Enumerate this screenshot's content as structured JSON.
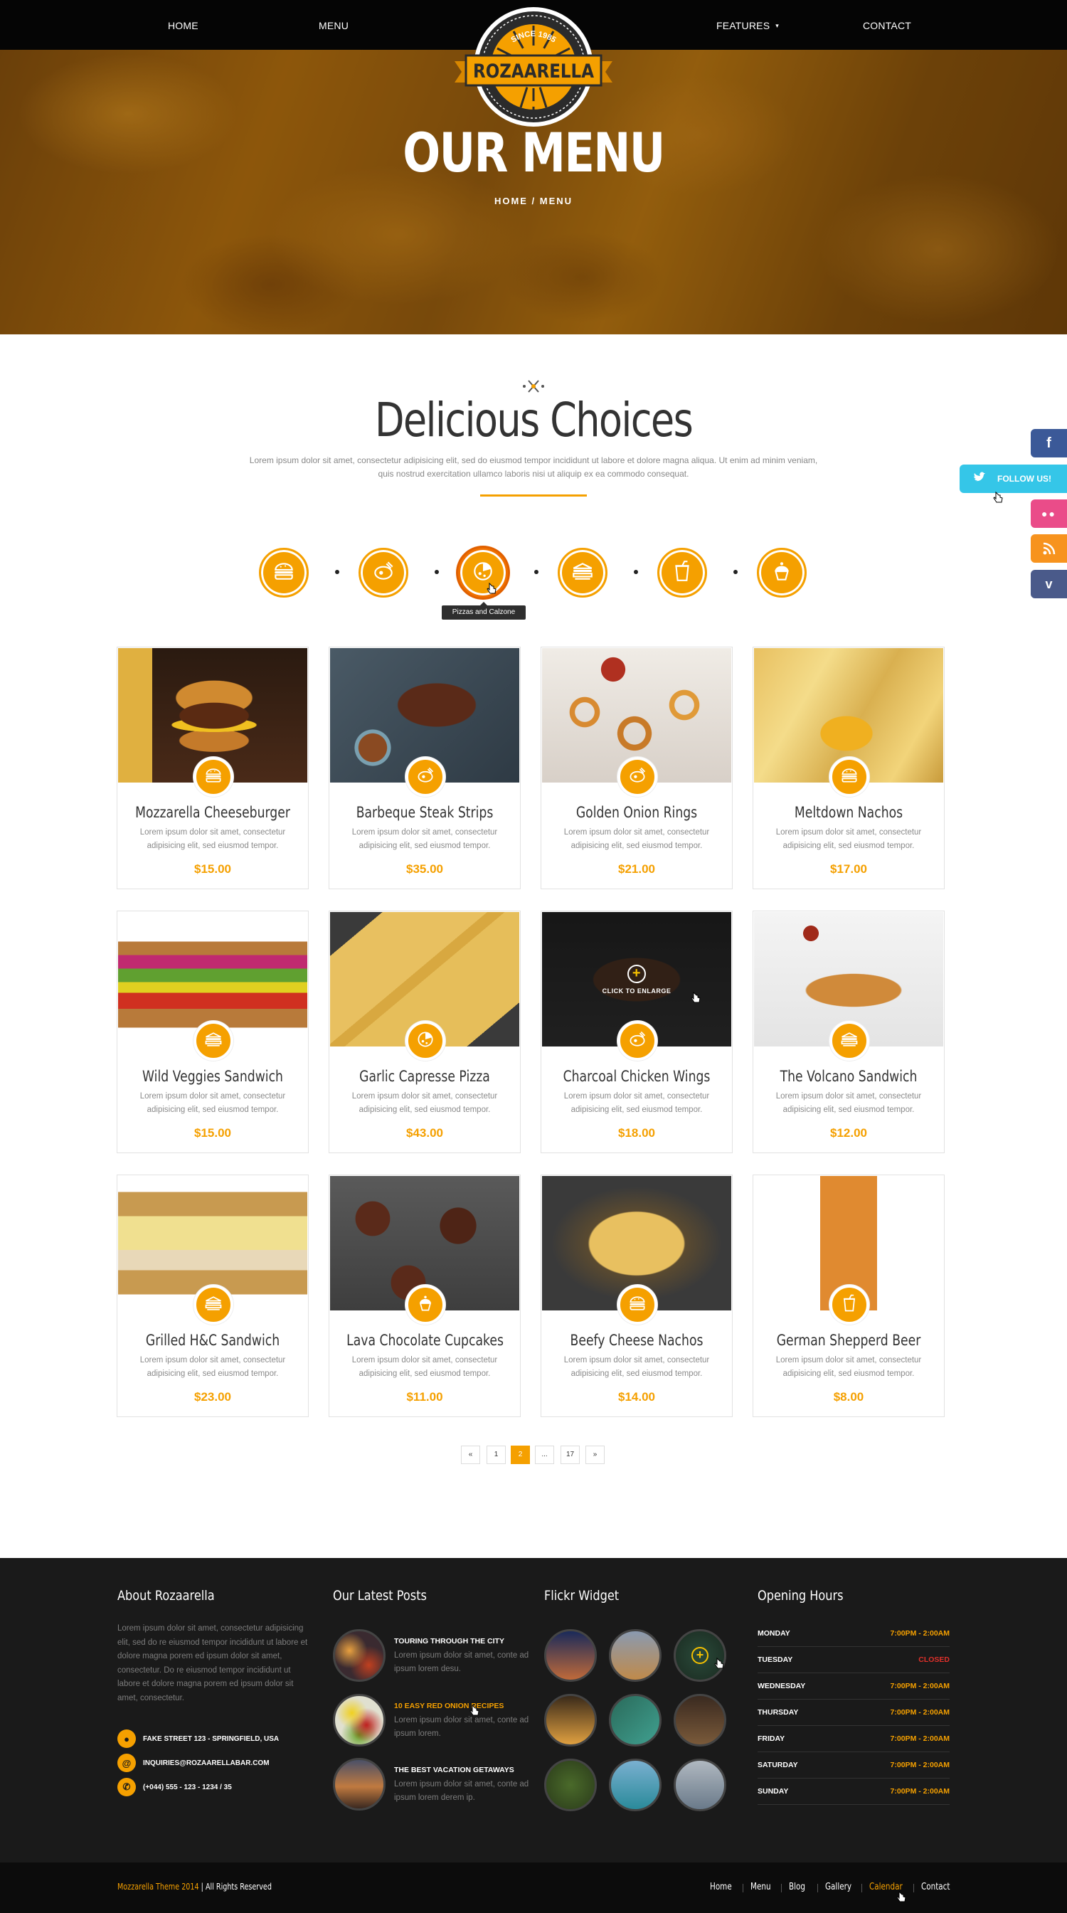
{
  "nav": {
    "home": "HOME",
    "menu": "MENU",
    "features": "FEATURES",
    "contact": "CONTACT"
  },
  "logo": {
    "since": "SINCE 1985",
    "name": "ROZAARELLA"
  },
  "hero": {
    "title": "OUR MENU",
    "breadcrumb": "HOME / MENU"
  },
  "intro": {
    "title": "Delicious Choices",
    "text": "Lorem ipsum dolor sit amet, consectetur adipisicing elit, sed do eiusmod tempor incididunt ut labore et dolore magna aliqua. Ut enim ad minim veniam, quis nostrud exercitation ullamco laboris nisi ut aliquip ex ea commodo consequat."
  },
  "categories": {
    "icons": [
      "burger-icon",
      "steak-icon",
      "pizza-icon",
      "sandwich-icon",
      "drink-icon",
      "cupcake-icon"
    ],
    "active_index": 2,
    "tooltip": "Pizzas and Calzone"
  },
  "colors": {
    "accent": "#f5a000",
    "dark": "#1a1a1a",
    "facebook": "#3b5998",
    "twitter": "#35c6e8",
    "flickr": "#ea4c89",
    "rss": "#f7931e",
    "vimeo": "#4a5a8a"
  },
  "menu_items": [
    {
      "name": "Mozzarella Cheeseburger",
      "desc": "Lorem ipsum dolor sit amet, consectetur adipisicing elit, sed eiusmod tempor.",
      "price": "$15.00",
      "icon": "burger-icon"
    },
    {
      "name": "Barbeque Steak Strips",
      "desc": "Lorem ipsum dolor sit amet, consectetur adipisicing elit, sed eiusmod tempor.",
      "price": "$35.00",
      "icon": "steak-icon"
    },
    {
      "name": "Golden Onion Rings",
      "desc": "Lorem ipsum dolor sit amet, consectetur adipisicing elit, sed eiusmod tempor.",
      "price": "$21.00",
      "icon": "steak-icon"
    },
    {
      "name": "Meltdown Nachos",
      "desc": "Lorem ipsum dolor sit amet, consectetur adipisicing elit, sed eiusmod tempor.",
      "price": "$17.00",
      "icon": "burger-icon"
    },
    {
      "name": "Wild Veggies Sandwich",
      "desc": "Lorem ipsum dolor sit amet, consectetur adipisicing elit, sed eiusmod tempor.",
      "price": "$15.00",
      "icon": "sandwich-icon"
    },
    {
      "name": "Garlic Capresse Pizza",
      "desc": "Lorem ipsum dolor sit amet, consectetur adipisicing elit, sed eiusmod tempor.",
      "price": "$43.00",
      "icon": "pizza-icon"
    },
    {
      "name": "Charcoal Chicken Wings",
      "desc": "Lorem ipsum dolor sit amet, consectetur adipisicing elit, sed eiusmod tempor.",
      "price": "$18.00",
      "icon": "steak-icon",
      "overlay": "CLICK TO ENLARGE"
    },
    {
      "name": "The Volcano Sandwich",
      "desc": "Lorem ipsum dolor sit amet, consectetur adipisicing elit, sed eiusmod tempor.",
      "price": "$12.00",
      "icon": "sandwich-icon"
    },
    {
      "name": "Grilled H&C Sandwich",
      "desc": "Lorem ipsum dolor sit amet, consectetur adipisicing elit, sed eiusmod tempor.",
      "price": "$23.00",
      "icon": "sandwich-icon"
    },
    {
      "name": "Lava Chocolate Cupcakes",
      "desc": "Lorem ipsum dolor sit amet, consectetur adipisicing elit, sed eiusmod tempor.",
      "price": "$11.00",
      "icon": "cupcake-icon"
    },
    {
      "name": "Beefy Cheese Nachos",
      "desc": "Lorem ipsum dolor sit amet, consectetur adipisicing elit, sed eiusmod tempor.",
      "price": "$14.00",
      "icon": "burger-icon"
    },
    {
      "name": "German Shepperd Beer",
      "desc": "Lorem ipsum dolor sit amet, consectetur adipisicing elit, sed eiusmod tempor.",
      "price": "$8.00",
      "icon": "drink-icon"
    }
  ],
  "pagination": {
    "prev": "«",
    "pages": [
      "1",
      "2",
      "...",
      "17"
    ],
    "active": "2",
    "next": "»"
  },
  "social": {
    "follow": "FOLLOW US!",
    "items": [
      "facebook-icon",
      "twitter-icon",
      "flickr-icon",
      "rss-icon",
      "vimeo-icon"
    ]
  },
  "footer": {
    "about": {
      "heading": "About Rozaarella",
      "text": "Lorem ipsum dolor sit amet, consectetur adipisicing elit, sed do re eiusmod tempor incididunt ut labore et dolore magna porem ed ipsum dolor sit amet, consectetur. Do re eiusmod tempor incididunt ut labore et dolore magna porem ed ipsum dolor sit amet, consectetur.",
      "address": "FAKE STREET 123 - SPRINGFIELD, USA",
      "email": "INQUIRIES@ROZAARELLABAR.COM",
      "phone": "(+044) 555 - 123 - 1234 / 35"
    },
    "posts": {
      "heading": "Our Latest Posts",
      "items": [
        {
          "title": "TOURING THROUGH THE CITY",
          "text": "Lorem ipsum dolor sit amet, conte ad ipsum lorem desu."
        },
        {
          "title": "10 EASY RED ONION RECIPES",
          "text": "Lorem ipsum dolor sit amet, conte ad ipsum lorem."
        },
        {
          "title": "THE BEST VACATION GETAWAYS",
          "text": "Lorem ipsum dolor sit amet, conte ad ipsum lorem derem ip."
        }
      ]
    },
    "flickr": {
      "heading": "Flickr Widget"
    },
    "hours": {
      "heading": "Opening Hours",
      "rows": [
        {
          "day": "MONDAY",
          "time": "7:00PM - 2:00AM"
        },
        {
          "day": "TUESDAY",
          "time": "CLOSED"
        },
        {
          "day": "WEDNESDAY",
          "time": "7:00PM - 2:00AM"
        },
        {
          "day": "THURSDAY",
          "time": "7:00PM - 2:00AM"
        },
        {
          "day": "FRIDAY",
          "time": "7:00PM - 2:00AM"
        },
        {
          "day": "SATURDAY",
          "time": "7:00PM - 2:00AM"
        },
        {
          "day": "SUNDAY",
          "time": "7:00PM - 2:00AM"
        }
      ]
    }
  },
  "bottombar": {
    "brand": "Mozzarella Theme 2014",
    "rights": " | All Rights Reserved",
    "links": [
      "Home",
      "Menu",
      "Blog",
      "Gallery",
      "Calendar",
      "Contact"
    ],
    "active_link": "Calendar"
  }
}
